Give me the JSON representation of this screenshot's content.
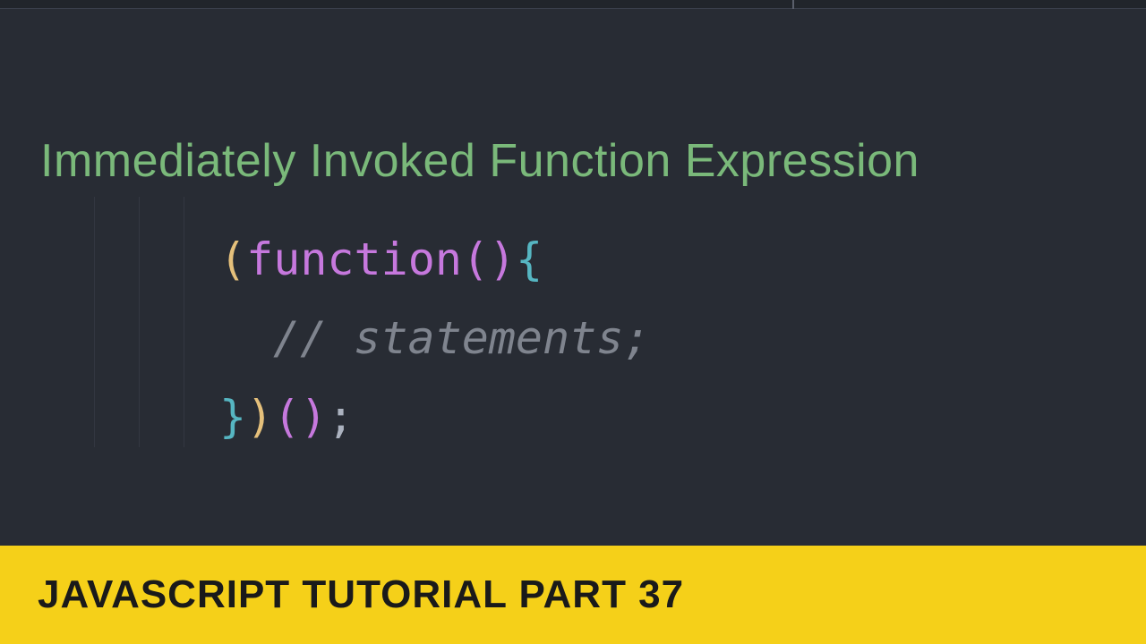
{
  "title": "Immediately Invoked Function Expression",
  "code": {
    "line1_paren_open": "(",
    "line1_keyword": "function",
    "line1_parens": "()",
    "line1_brace": "{",
    "line2_comment": "// statements;",
    "line3_brace_close": "}",
    "line3_paren_close": ")",
    "line3_invoke_open": "(",
    "line3_invoke_close": ")",
    "line3_semicolon": ";"
  },
  "banner": "JAVASCRIPT TUTORIAL PART 37"
}
